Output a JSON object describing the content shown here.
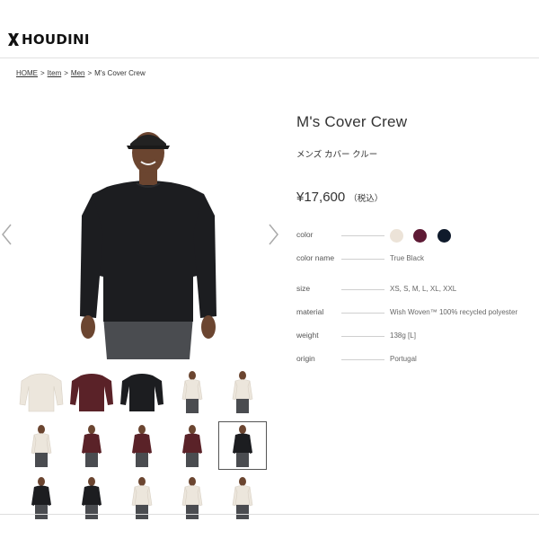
{
  "brand": {
    "name": "HOUDINI"
  },
  "breadcrumb": {
    "items": [
      "HOME",
      "Item",
      "Men",
      "M's Cover Crew"
    ],
    "separator": ">"
  },
  "product": {
    "title": "M's Cover Crew",
    "subtitle": "メンズ カバー クルー",
    "price": "¥17,600",
    "price_note": "（税込）"
  },
  "specs": {
    "color_label": "color",
    "color_name_label": "color name",
    "color_name_value": "True Black",
    "size_label": "size",
    "size_value": "XS, S, M, L, XL, XXL",
    "material_label": "material",
    "material_value": "Wish Woven™ 100% recycled polyester",
    "weight_label": "weight",
    "weight_value": "138g [L]",
    "origin_label": "origin",
    "origin_value": "Portugal"
  },
  "swatches": [
    {
      "name": "cream",
      "color": "#ece3d8"
    },
    {
      "name": "burgundy",
      "color": "#5e1a35"
    },
    {
      "name": "navy",
      "color": "#0f1a2b"
    }
  ],
  "colors": {
    "black_garment": "#1c1d20",
    "cream_garment": "#ece6dc",
    "red_garment": "#5a2228",
    "skin": "#6b4530",
    "pants_grey": "#4a4c50"
  },
  "gallery": {
    "selected_index": 9,
    "thumbnails": [
      {
        "kind": "flat",
        "garment": "cream"
      },
      {
        "kind": "flat",
        "garment": "red"
      },
      {
        "kind": "flat",
        "garment": "black"
      },
      {
        "kind": "model",
        "garment": "cream"
      },
      {
        "kind": "model",
        "garment": "cream"
      },
      {
        "kind": "model",
        "garment": "cream"
      },
      {
        "kind": "model",
        "garment": "red"
      },
      {
        "kind": "model",
        "garment": "red"
      },
      {
        "kind": "model",
        "garment": "red"
      },
      {
        "kind": "model",
        "garment": "black"
      },
      {
        "kind": "model",
        "garment": "black"
      },
      {
        "kind": "model",
        "garment": "black"
      },
      {
        "kind": "model",
        "garment": "cream"
      },
      {
        "kind": "model",
        "garment": "cream"
      },
      {
        "kind": "model",
        "garment": "cream"
      }
    ]
  }
}
